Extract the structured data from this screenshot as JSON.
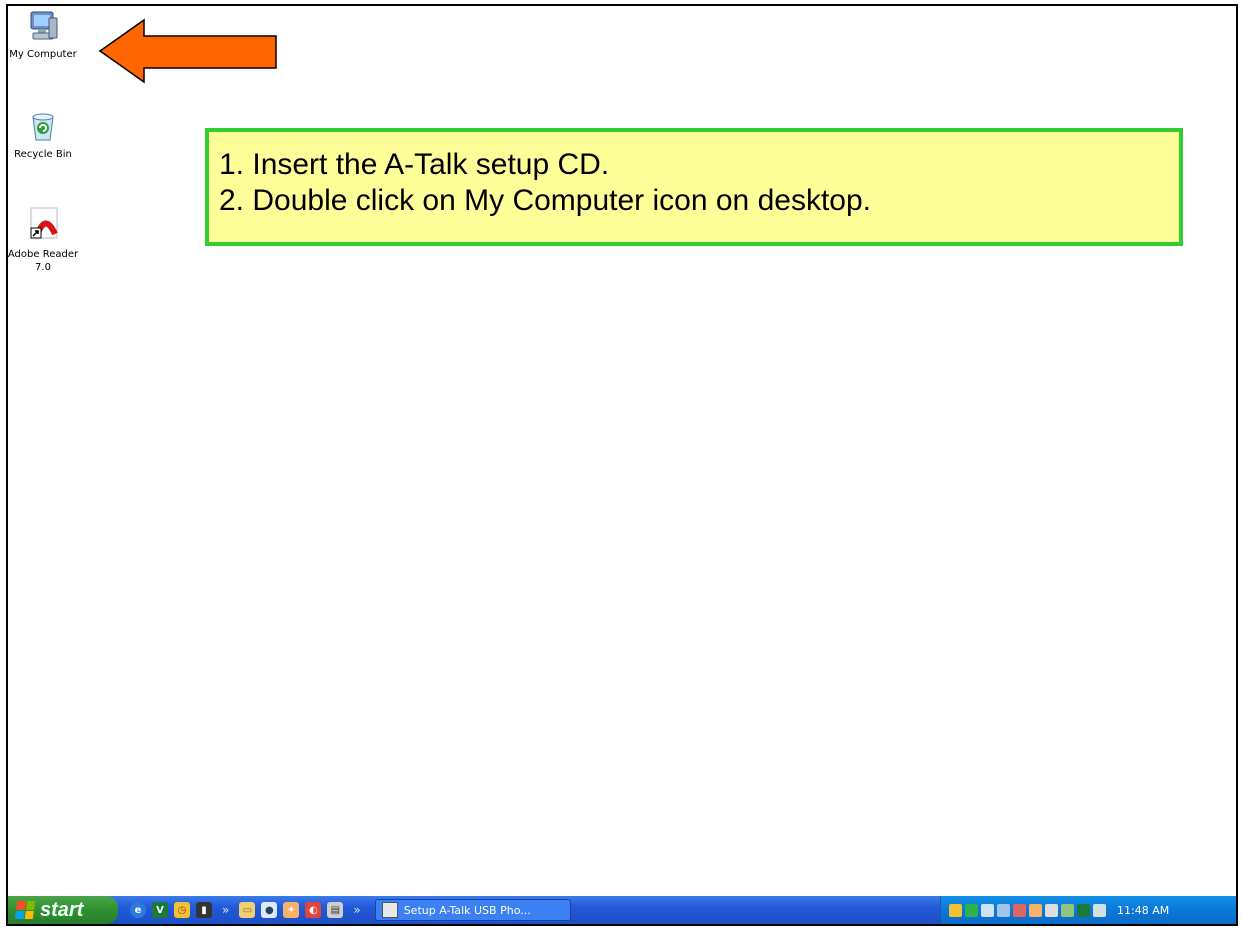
{
  "desktop": {
    "icons": [
      {
        "label": "My Computer",
        "icon": "my-computer-icon"
      },
      {
        "label": "Recycle Bin",
        "icon": "recycle-bin-icon"
      },
      {
        "label_line1": "Adobe Reader",
        "label_line2": "7.0",
        "icon": "adobe-reader-icon"
      }
    ]
  },
  "callout": {
    "line1": "1. Insert the A-Talk setup CD.",
    "line2": "2. Double click on My Computer icon on desktop.",
    "border_color": "#33cc33",
    "background": "#ffff99"
  },
  "arrow": {
    "color": "#ff6600",
    "points_to": "My Computer"
  },
  "taskbar": {
    "start_label": "start",
    "quick_launch": [
      "internet-explorer-icon",
      "vc-icon",
      "clock-app-icon",
      "app-icon",
      "folder-icon",
      "bulb-icon",
      "paint-icon",
      "red-app-icon",
      "printer-icon"
    ],
    "task_button_label": "Setup A-Talk USB Pho...",
    "clock": "11:48 AM"
  }
}
